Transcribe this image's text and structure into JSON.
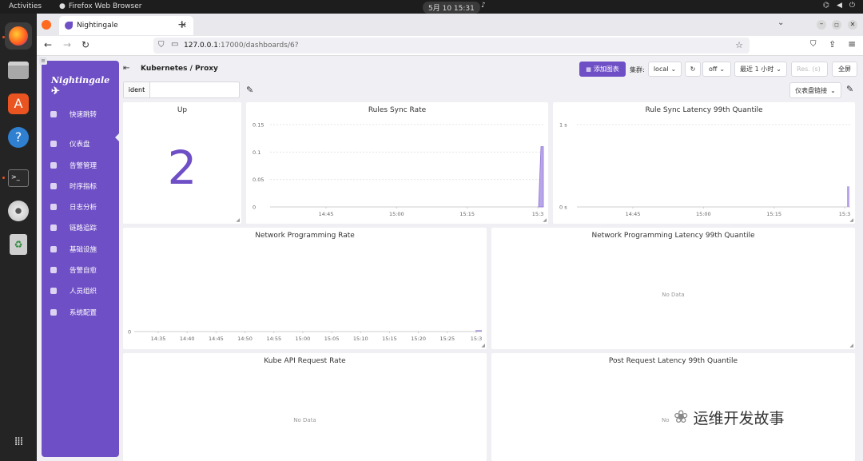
{
  "system": {
    "activities": "Activities",
    "app_name": "Firefox Web Browser",
    "clock": "5月 10 15:31"
  },
  "browser": {
    "tab_title": "Nightingale",
    "url_host": "127.0.0.1",
    "url_path": ":17000/dashboards/6?"
  },
  "sidebar": {
    "logo": "Nightingale",
    "items": [
      {
        "label": "快速跳转",
        "icon": "search-icon"
      },
      {
        "label": "仪表盘",
        "icon": "dashboard-icon"
      },
      {
        "label": "告警管理",
        "icon": "bell-icon"
      },
      {
        "label": "时序指标",
        "icon": "chart-icon"
      },
      {
        "label": "日志分析",
        "icon": "file-icon"
      },
      {
        "label": "链路追踪",
        "icon": "trace-icon"
      },
      {
        "label": "基础设施",
        "icon": "infra-icon"
      },
      {
        "label": "告警自愈",
        "icon": "heal-icon"
      },
      {
        "label": "人员组织",
        "icon": "user-icon"
      },
      {
        "label": "系统配置",
        "icon": "settings-icon"
      }
    ]
  },
  "dashboard": {
    "title": "Kubernetes / Proxy",
    "add_chart": "添加图表",
    "cluster_label": "集群:",
    "cluster_value": "local",
    "refresh_value": "off",
    "time_range": "最近 1 小时",
    "res_placeholder": "Res. (s)",
    "fullscreen": "全屏",
    "var_name": "ident",
    "var_value": "",
    "links": "仪表盘链接"
  },
  "panels": {
    "up": {
      "title": "Up",
      "value": "2",
      "color": "#6f4fc6"
    },
    "rules_sync": {
      "title": "Rules Sync Rate"
    },
    "rule_latency": {
      "title": "Rule Sync Latency 99th Quantile"
    },
    "net_rate": {
      "title": "Network Programming Rate"
    },
    "net_latency": {
      "title": "Network Programming Latency 99th Quantile",
      "nodata": "No Data"
    },
    "kube_api": {
      "title": "Kube API Request Rate",
      "nodata": "No Data"
    },
    "post_latency": {
      "title": "Post Request Latency 99th Quantile",
      "nodata": "No"
    }
  },
  "chart_data": [
    {
      "type": "area",
      "x": [
        "14:45",
        "15:00",
        "15:15",
        "15:3"
      ],
      "y_ticks": [
        "0.15",
        "0.1",
        "0.05",
        "0"
      ],
      "series": [
        {
          "values": [
            0,
            0,
            0,
            0.11
          ]
        }
      ],
      "ylim": [
        0,
        0.15
      ]
    },
    {
      "type": "bar",
      "x": [
        "14:45",
        "15:00",
        "15:15",
        "15:3"
      ],
      "y_ticks": [
        "1 s",
        "0 s"
      ],
      "series": [
        {
          "values": [
            0,
            0,
            0,
            0.25
          ]
        }
      ],
      "ylim": [
        0,
        1
      ]
    },
    {
      "type": "line",
      "x": [
        "14:35",
        "14:40",
        "14:45",
        "14:50",
        "14:55",
        "15:00",
        "15:05",
        "15:10",
        "15:15",
        "15:20",
        "15:25",
        "15:3"
      ],
      "y_ticks": [
        "0"
      ],
      "series": [
        {
          "values": [
            0,
            0,
            0,
            0,
            0,
            0,
            0,
            0,
            0,
            0,
            0,
            0
          ]
        }
      ]
    }
  ],
  "watermark": "运维开发故事"
}
